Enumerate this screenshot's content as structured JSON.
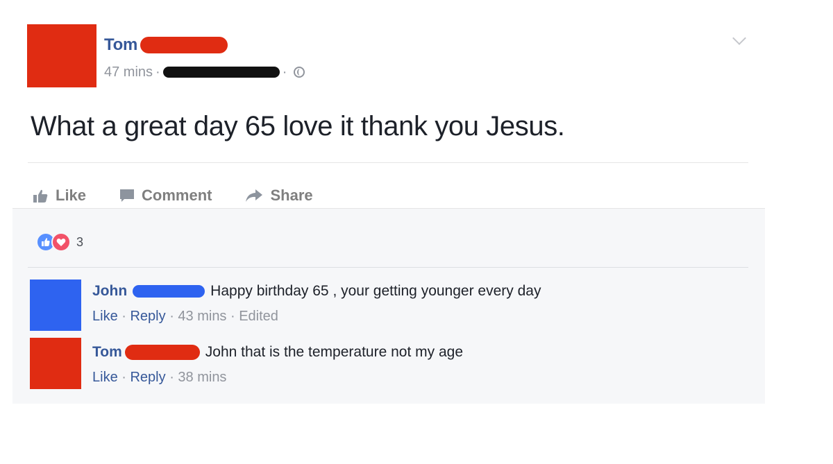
{
  "post": {
    "author": "Tom",
    "time": "47 mins",
    "text": "What a great day 65 love it thank you Jesus.",
    "avatar_color": "#e02c12",
    "redaction_color": "#e02c12",
    "audience_redaction_color": "#111111"
  },
  "actions": {
    "like": "Like",
    "comment": "Comment",
    "share": "Share"
  },
  "reactions": {
    "count": "3",
    "like_color": "#5890ff",
    "love_color": "#f25268"
  },
  "comments": [
    {
      "author": "John",
      "text": "Happy birthday 65 , your getting younger every day",
      "like": "Like",
      "reply": "Reply",
      "time": "43 mins",
      "edited": "Edited",
      "avatar_color": "#2e63f0",
      "redaction_color": "#2e63f0"
    },
    {
      "author": "Tom",
      "text": "John that is the temperature not my age",
      "like": "Like",
      "reply": "Reply",
      "time": "38 mins",
      "avatar_color": "#e02c12",
      "redaction_color": "#e02c12"
    }
  ],
  "colors": {
    "link": "#365899",
    "meta": "#90949c",
    "body_text": "#1d2129"
  }
}
